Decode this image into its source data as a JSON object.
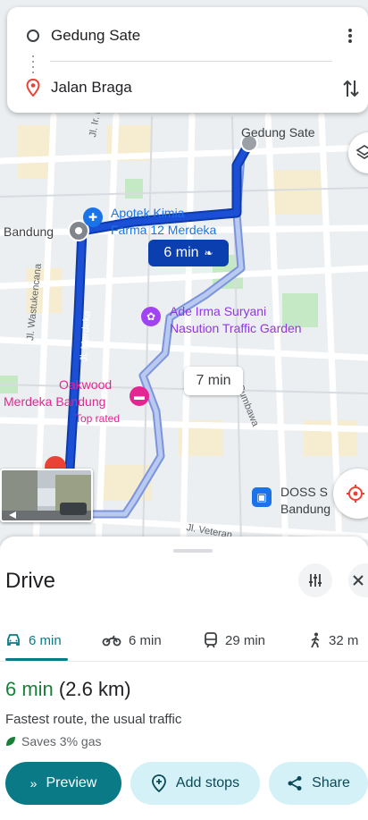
{
  "search": {
    "origin": "Gedung Sate",
    "destination": "Jalan Braga"
  },
  "map": {
    "labels": {
      "gedung_sate": "Gedung Sate",
      "bandung": "Bandung",
      "apotek_line1": "Apotek Kimia",
      "apotek_line2": "Farma 12 Merdeka",
      "ade_line1": "Ade Irma Suryani",
      "ade_line2": "Nasution Traffic Garden",
      "oakwood_line1": "Oakwood",
      "oakwood_line2": "Merdeka Bandung",
      "oakwood_sub": "Top rated",
      "doss_line1": "DOSS S",
      "doss_line2": "Bandung",
      "street_merdeka": "Jl. Merdeka",
      "street_wastukencana": "Jl. Wastukencana",
      "street_juanda": "Jl. Ir. H. Juanda",
      "street_sumbawa": "Jl. Sumbawa",
      "street_veteran": "Jl. Veteran"
    },
    "primary_route_time": "6 min",
    "alt_route_time": "7 min"
  },
  "sheet": {
    "title": "Drive",
    "modes": [
      {
        "name": "drive",
        "label": "6 min"
      },
      {
        "name": "motorcycle",
        "label": "6 min"
      },
      {
        "name": "transit",
        "label": "29 min"
      },
      {
        "name": "walk",
        "label": "32 m"
      }
    ],
    "duration": "6 min",
    "distance": "(2.6 km)",
    "description": "Fastest route, the usual traffic",
    "eco": "Saves 3% gas",
    "buttons": {
      "preview": "Preview",
      "add_stops": "Add stops",
      "share": "Share"
    }
  },
  "colors": {
    "primary_route": "#1a4fd6",
    "alt_route": "#9fb4e8",
    "accent": "#0b7a87",
    "duration_green": "#188038"
  }
}
